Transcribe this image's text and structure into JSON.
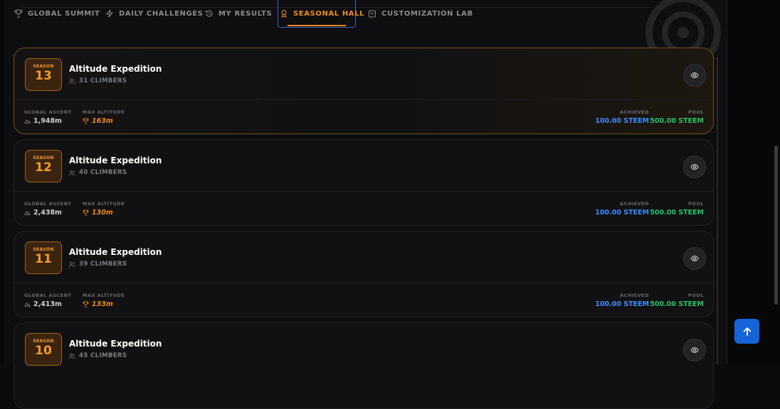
{
  "tabs": [
    {
      "label": "GLOBAL SUMMIT",
      "icon": "trophy-icon"
    },
    {
      "label": "DAILY CHALLENGES",
      "icon": "lightning-icon"
    },
    {
      "label": "MY RESULTS",
      "icon": "history-icon"
    },
    {
      "label": "SEASONAL HALL",
      "icon": "medal-icon",
      "active": true
    },
    {
      "label": "CUSTOMIZATION LAB",
      "icon": "bag-icon"
    }
  ],
  "labels": {
    "season": "SEASON",
    "global_ascent": "GLOBAL ASCENT",
    "max_altitude": "MAX ALTITUDE",
    "achieved": "ACHIEVED",
    "pool": "POOL"
  },
  "seasons": [
    {
      "season": "13",
      "title": "Altitude Expedition",
      "climbers": "31 CLIMBERS",
      "global_ascent": "1,948m",
      "max_altitude": "163m",
      "achieved": "100.00 STEEM",
      "pool": "500.00 STEEM",
      "featured": true
    },
    {
      "season": "12",
      "title": "Altitude Expedition",
      "climbers": "40 CLIMBERS",
      "global_ascent": "2,438m",
      "max_altitude": "130m",
      "achieved": "100.00 STEEM",
      "pool": "500.00 STEEM"
    },
    {
      "season": "11",
      "title": "Altitude Expedition",
      "climbers": "39 CLIMBERS",
      "global_ascent": "2,413m",
      "max_altitude": "133m",
      "achieved": "100.00 STEEM",
      "pool": "500.00 STEEM"
    },
    {
      "season": "10",
      "title": "Altitude Expedition",
      "climbers": "45 CLIMBERS"
    }
  ],
  "colors": {
    "accent": "#f08a1c",
    "achieved": "#3d8bff",
    "pool": "#21c46b",
    "fab": "#1565d8"
  }
}
